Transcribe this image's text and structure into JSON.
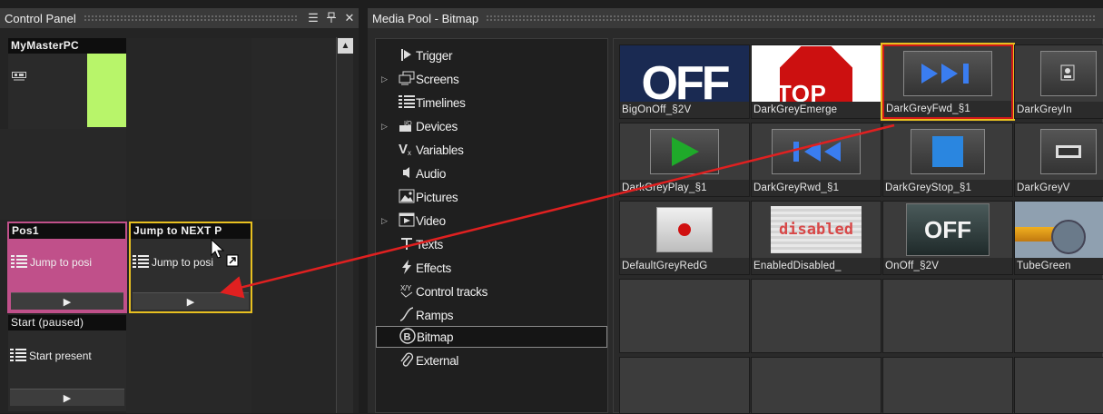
{
  "control_panel": {
    "title": "Control Panel",
    "buttons": {
      "menu": "☰",
      "pin": "ꟷ",
      "close": "✕"
    },
    "cells": {
      "master": {
        "head": "MyMasterPC",
        "accent": "#b8f56a"
      },
      "pos1": {
        "head": "Pos1",
        "body": "Jump to posi",
        "play": "▶",
        "color": "#c0508a"
      },
      "jump": {
        "head": "Jump to NEXT P",
        "body": "Jump to posi",
        "play": "▶",
        "color": "#e8c020"
      },
      "start": {
        "head": "Start (paused)",
        "body": "Start present",
        "play": "▶"
      }
    },
    "scroll_up": "▲"
  },
  "media_pool": {
    "title": "Media Pool - Bitmap",
    "tree": [
      {
        "label": "Trigger",
        "icon": "trigger-icon",
        "expand": ""
      },
      {
        "label": "Screens",
        "icon": "screens-icon",
        "expand": "▷"
      },
      {
        "label": "Timelines",
        "icon": "timelines-icon",
        "expand": ""
      },
      {
        "label": "Devices",
        "icon": "devices-icon",
        "expand": "▷"
      },
      {
        "label": "Variables",
        "icon": "variables-icon",
        "expand": ""
      },
      {
        "label": "Audio",
        "icon": "audio-icon",
        "expand": ""
      },
      {
        "label": "Pictures",
        "icon": "pictures-icon",
        "expand": ""
      },
      {
        "label": "Video",
        "icon": "video-icon",
        "expand": "▷"
      },
      {
        "label": "Texts",
        "icon": "texts-icon",
        "expand": ""
      },
      {
        "label": "Effects",
        "icon": "effects-icon",
        "expand": ""
      },
      {
        "label": "Control tracks",
        "icon": "control-tracks-icon",
        "expand": ""
      },
      {
        "label": "Ramps",
        "icon": "ramps-icon",
        "expand": ""
      },
      {
        "label": "Bitmap",
        "icon": "bitmap-icon",
        "expand": "",
        "selected": true
      },
      {
        "label": "External",
        "icon": "external-icon",
        "expand": ""
      }
    ],
    "tiles": [
      {
        "label": "BigOnOff_§2V",
        "thumb": "OFF"
      },
      {
        "label": "DarkGreyEmerge",
        "thumb": "STOP"
      },
      {
        "label": "DarkGreyFwd_§1",
        "thumb": "fwd",
        "selected": true
      },
      {
        "label": "DarkGreyIn",
        "thumb": "in"
      },
      {
        "label": "DarkGreyPlay_§1",
        "thumb": "play"
      },
      {
        "label": "DarkGreyRwd_§1",
        "thumb": "rwd"
      },
      {
        "label": "DarkGreyStop_§1",
        "thumb": "stop"
      },
      {
        "label": "DarkGreyV",
        "thumb": "film"
      },
      {
        "label": "DefaultGreyRedG",
        "thumb": "red-dot"
      },
      {
        "label": "EnabledDisabled_",
        "thumb": "disabled"
      },
      {
        "label": "OnOff_§2V",
        "thumb": "OFF2"
      },
      {
        "label": "TubeGreen",
        "thumb": "tube"
      }
    ],
    "thumb_text": {
      "off": "OFF",
      "stop": "STOP",
      "disabled": "disabled",
      "off2": "OFF"
    }
  }
}
